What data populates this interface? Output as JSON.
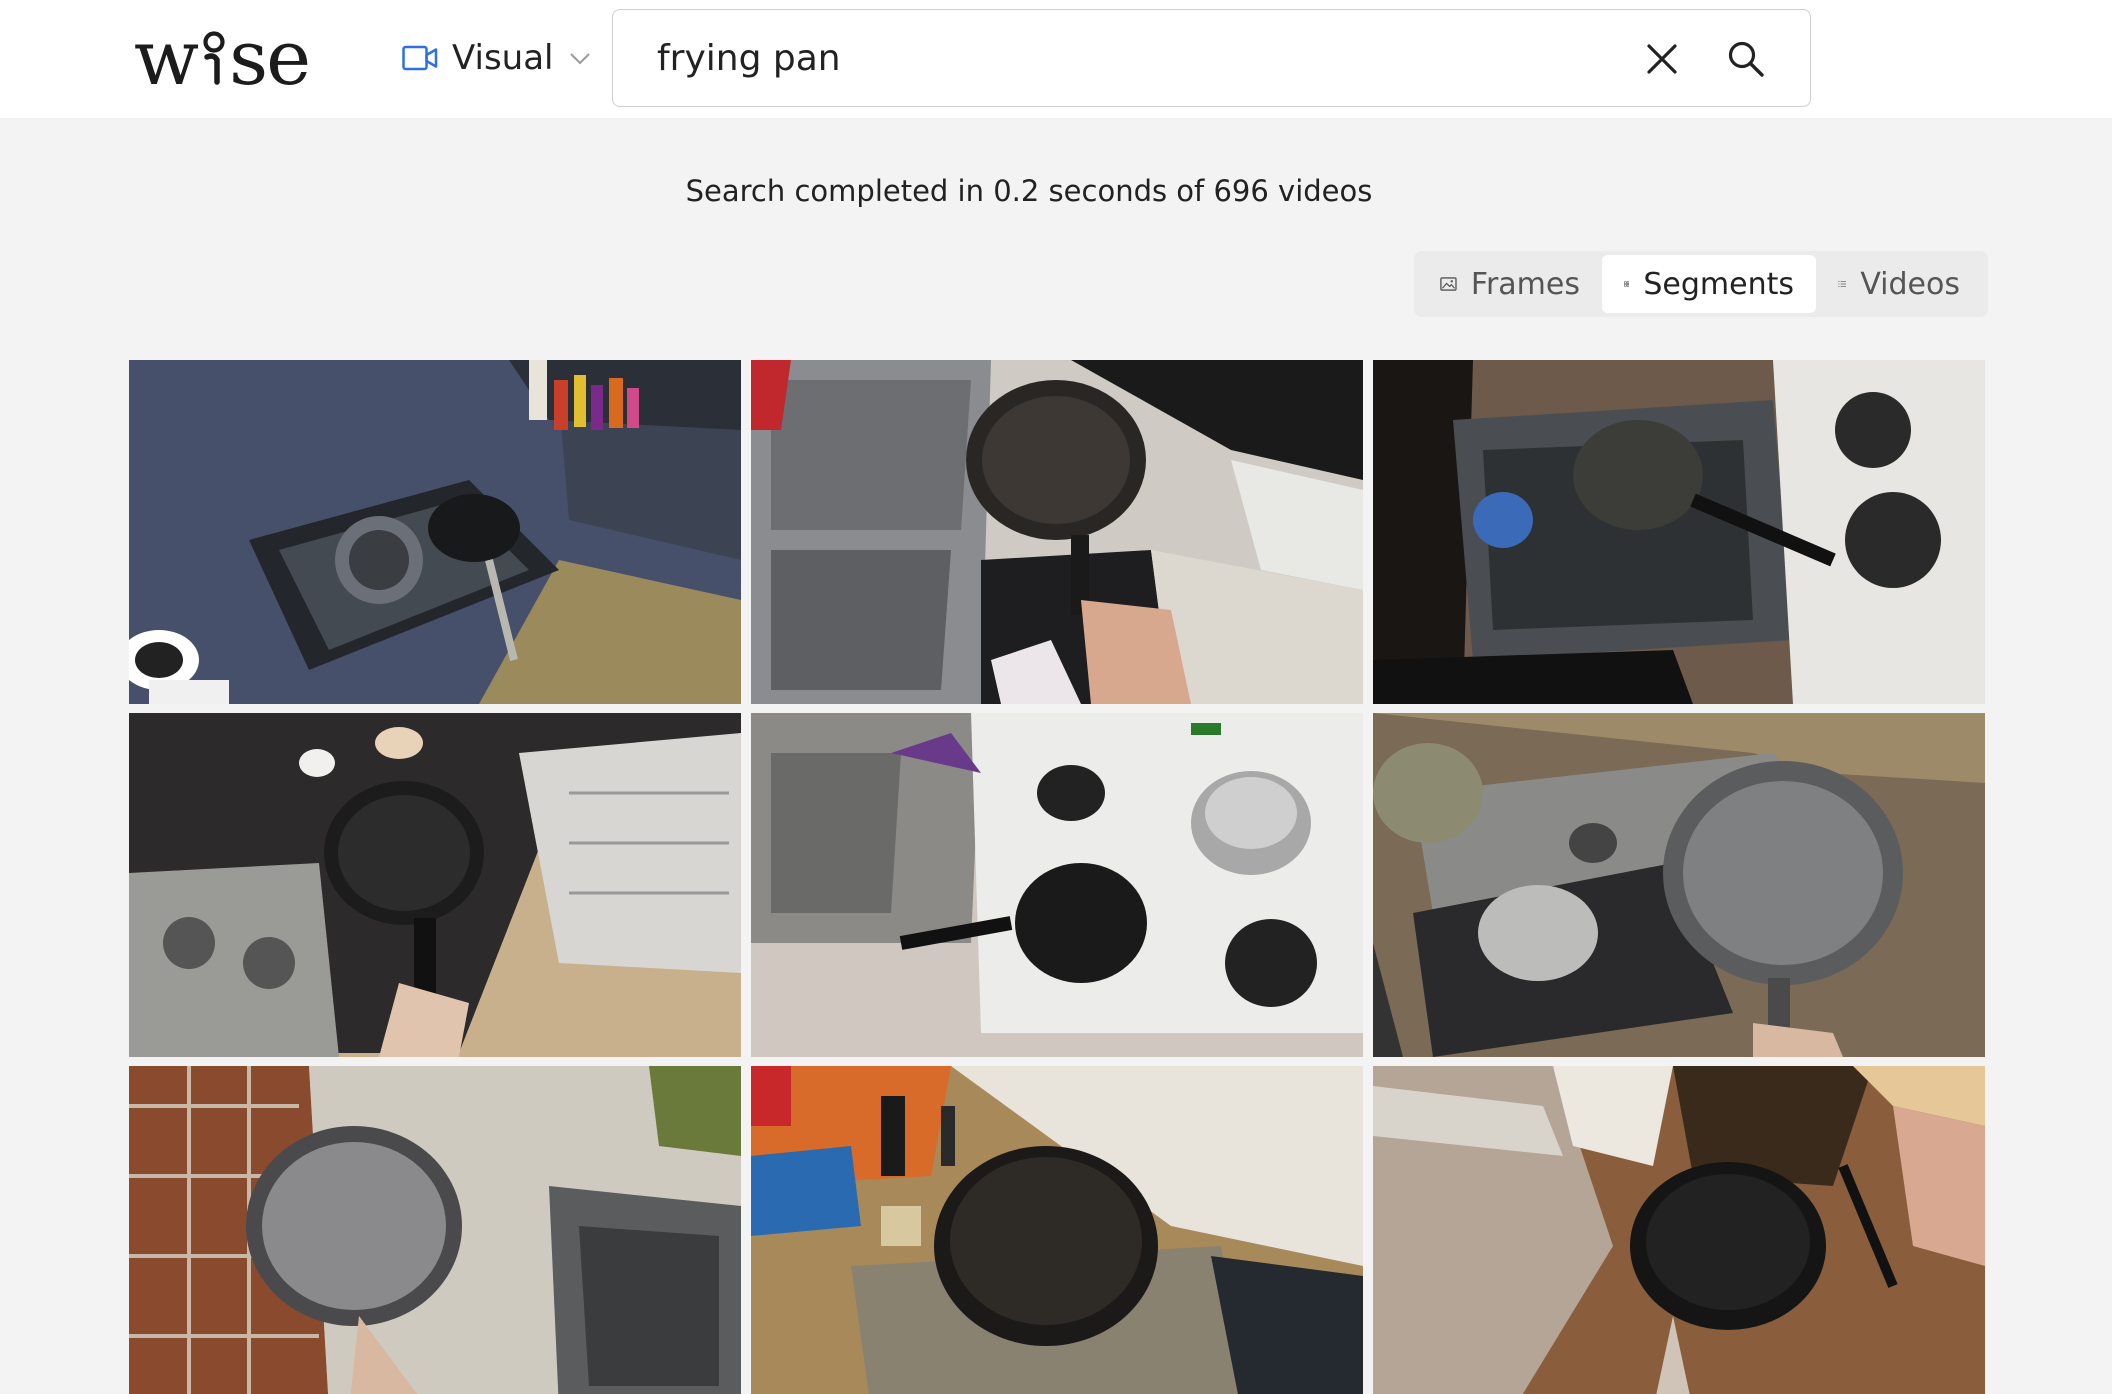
{
  "app": {
    "logo_text_left": "w",
    "logo_text_right": "se"
  },
  "header": {
    "mode": {
      "label": "Visual",
      "icon": "video-camera-icon",
      "expanded": false
    },
    "search": {
      "value": "frying pan",
      "placeholder": "",
      "clear_icon": "close-icon",
      "submit_icon": "search-icon"
    }
  },
  "status": {
    "text": "Search completed in 0.2 seconds of 696 videos"
  },
  "view_toggle": {
    "tabs": [
      {
        "label": "Frames",
        "icon": "image-icon",
        "active": false
      },
      {
        "label": "Segments",
        "icon": "grid-icon",
        "active": true
      },
      {
        "label": "Videos",
        "icon": "list-icon",
        "active": false
      }
    ]
  },
  "results": {
    "items": [
      {
        "scene": "granite counter with gas stove and frying pan"
      },
      {
        "scene": "hand holding frying pan over sink"
      },
      {
        "scene": "frying pan over sink next to electric stove"
      },
      {
        "scene": "hand holding black frying pan near gas stove"
      },
      {
        "scene": "white electric stove with black frying pan and pot"
      },
      {
        "scene": "hand holding grey frying pan over dish rack"
      },
      {
        "scene": "hand holding grey frying pan over tiled floor"
      },
      {
        "scene": "black frying pan over stovetop"
      },
      {
        "scene": "black frying pan held over wooden counter"
      }
    ]
  },
  "colors": {
    "accent": "#2f6fe4",
    "header_bg": "#ffffff",
    "page_bg": "#f3f3f3",
    "active_tab_bg": "#ffffff",
    "toggle_bg": "#ebebeb"
  }
}
